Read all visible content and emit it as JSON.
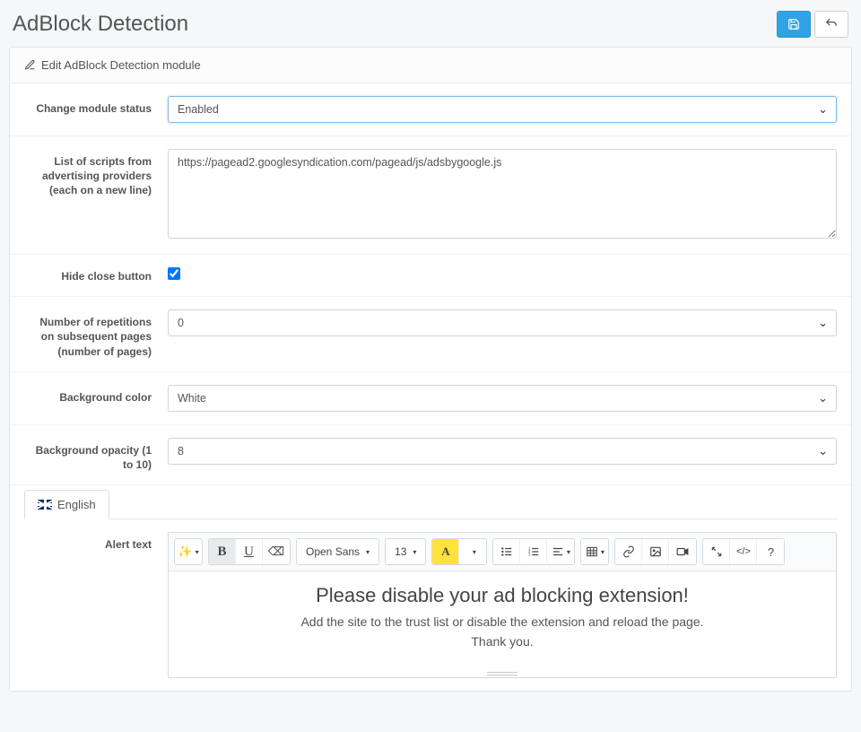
{
  "page": {
    "title": "AdBlock Detection"
  },
  "panel": {
    "heading": "Edit AdBlock Detection module"
  },
  "labels": {
    "status": "Change module status",
    "scripts": "List of scripts from advertising providers (each on a new line)",
    "hide_close": "Hide close button",
    "repetitions": "Number of repetitions on subsequent pages (number of pages)",
    "bg_color": "Background color",
    "bg_opacity": "Background opacity (1 to 10)",
    "alert_text": "Alert text"
  },
  "values": {
    "status": "Enabled",
    "scripts": "https://pagead2.googlesyndication.com/pagead/js/adsbygoogle.js",
    "hide_close": true,
    "repetitions": "0",
    "bg_color": "White",
    "bg_opacity": "8"
  },
  "tabs": {
    "english": "English"
  },
  "toolbar": {
    "font": "Open Sans",
    "size": "13"
  },
  "alert": {
    "heading": "Please disable your ad blocking extension!",
    "line1": "Add the site to the trust list or disable the extension and reload the page.",
    "line2": "Thank you."
  }
}
